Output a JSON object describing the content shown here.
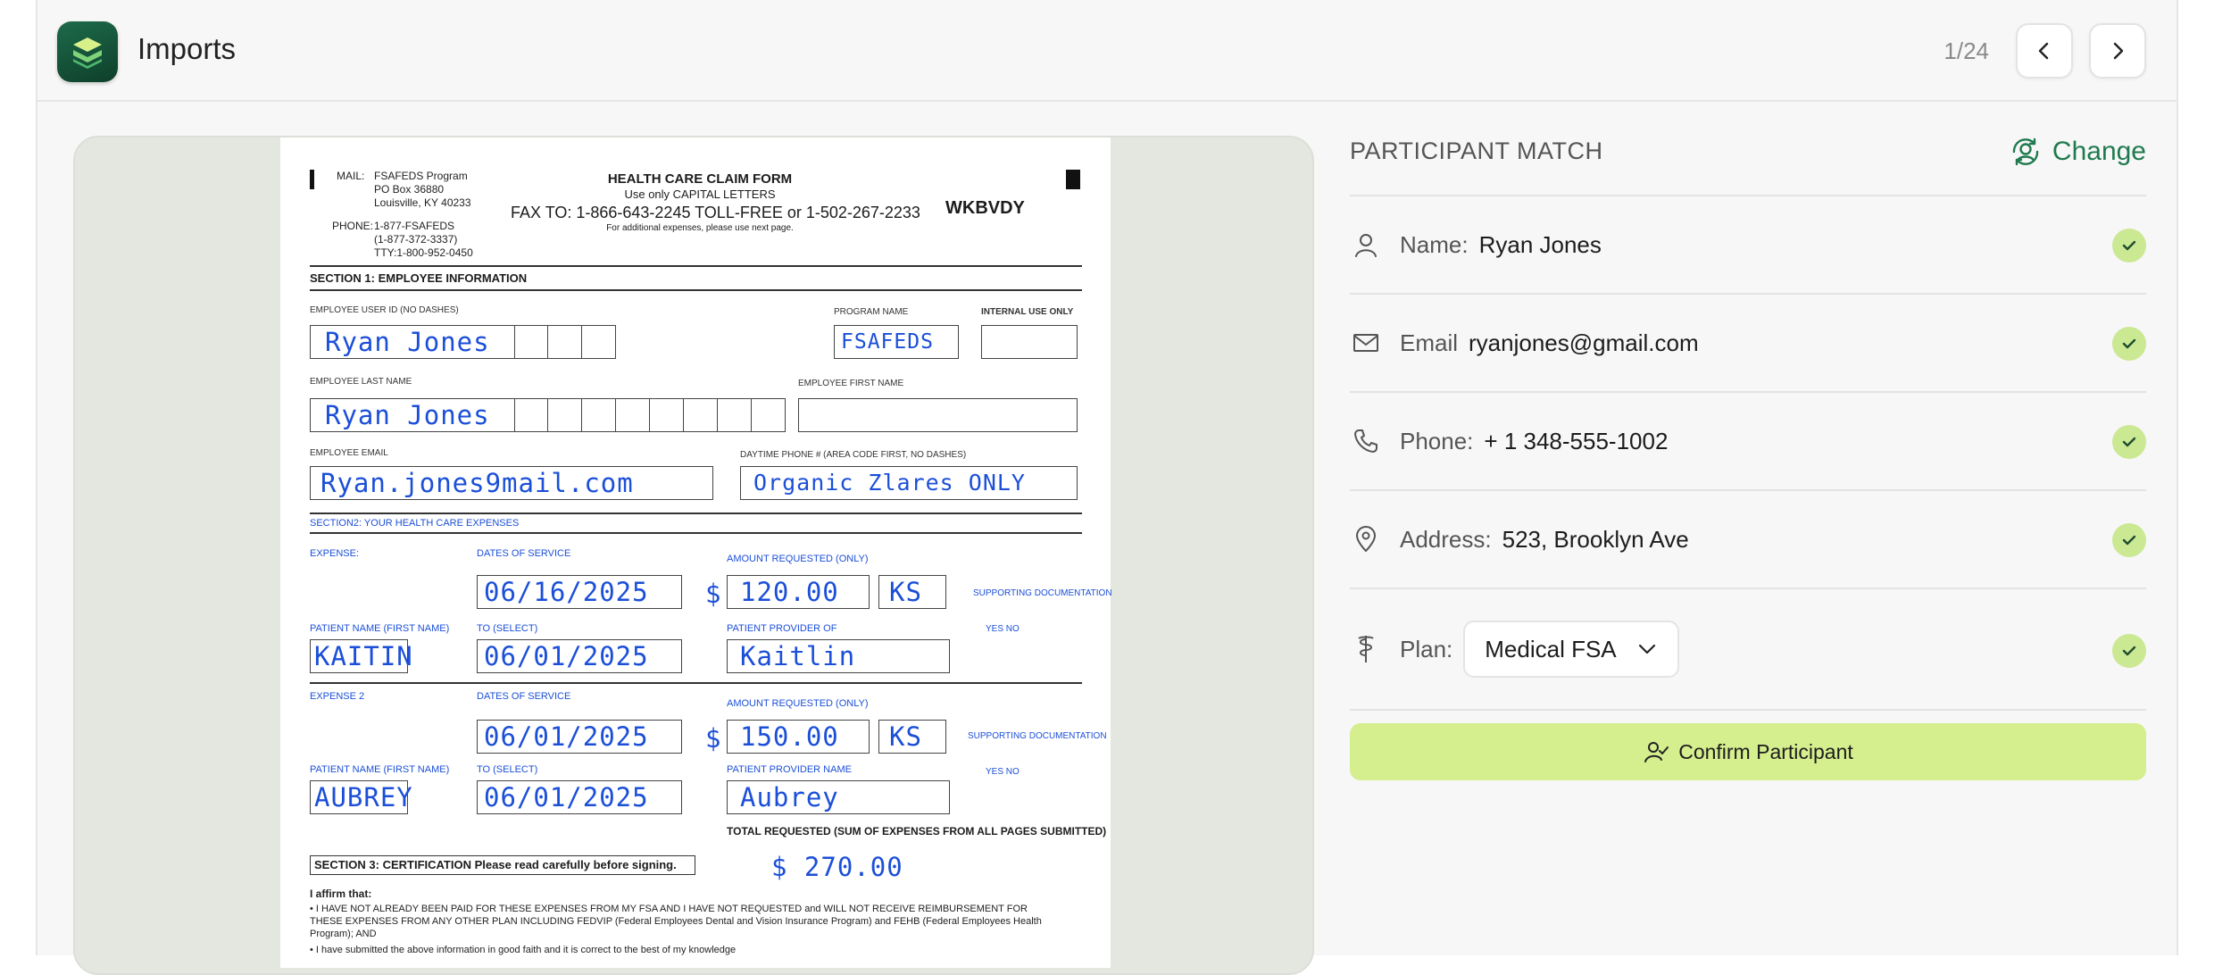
{
  "header": {
    "app_title": "Imports",
    "pager": "1/24",
    "logo_icon": "layers-logo-icon",
    "prev_icon": "chevron-left-icon",
    "next_icon": "chevron-right-icon"
  },
  "document": {
    "mail_label": "MAIL:",
    "mail_lines": [
      "FSAFEDS Program",
      "PO Box 36880",
      "Louisville, KY 40233"
    ],
    "phone_label": "PHONE:",
    "phone_lines": [
      "1-877-FSAFEDS",
      "(1-877-372-3337)",
      "TTY:1-800-952-0450"
    ],
    "form_title": "HEALTH CARE CLAIM FORM",
    "form_subtitle": "Use only CAPITAL LETTERS",
    "fax_line": "FAX TO:  1-866-643-2245  TOLL-FREE or 1-502-267-2233",
    "fax_sub": "For additional expenses, please use next page.",
    "form_code": "WKBVDY",
    "section1": "SECTION 1:  EMPLOYEE INFORMATION",
    "employee_user_id_label": "EMPLOYEE USER ID (NO DASHES)",
    "program_name_label": "PROGRAM NAME",
    "internal_use_label": "INTERNAL USE ONLY",
    "employee_user_id_value": "Ryan Jones",
    "program_name_value": "FSAFEDS",
    "last_name_label": "EMPLOYEE LAST NAME",
    "first_name_label": "EMPLOYEE FIRST NAME",
    "last_name_value": "Ryan Jones",
    "email_label": "EMPLOYEE EMAIL",
    "phone_field_label": "DAYTIME PHONE # (AREA CODE FIRST, NO DASHES)",
    "email_value": "Ryan.jones9mail.com",
    "phone_value": "Organic Zlares ONLY",
    "section2": "SECTION2:  YOUR HEALTH CARE EXPENSES",
    "exp1_label": "EXPENSE:",
    "exp1_dates_label": "DATES OF SERVICE",
    "exp1_amount_label": "AMOUNT REQUESTED (ONLY)",
    "exp1_date_from": "06/16/2025",
    "exp1_amount": "120.00",
    "exp1_cents": "KS",
    "exp1_patient_label": "PATIENT NAME (FIRST NAME)",
    "exp1_to_label": "TO (SELECT)",
    "exp1_provider_label": "PATIENT PROVIDER OF",
    "exp1_patient": "KAITIN",
    "exp1_date_to": "06/01/2025",
    "exp1_provider": "Kaitlin",
    "exp1_support": "SUPPORTING DOCUMENTATION",
    "exp1_yes_no": "YES      NO",
    "exp2_label": "EXPENSE 2",
    "exp2_dates_label": "DATES OF SERVICE",
    "exp2_amount_label": "AMOUNT REQUESTED (ONLY)",
    "exp2_date_from": "06/01/2025",
    "exp2_amount": "150.00",
    "exp2_cents": "KS",
    "exp2_patient_label": "PATIENT NAME (FIRST NAME)",
    "exp2_to_label": "TO (SELECT)",
    "exp2_provider_label": "PATIENT PROVIDER NAME",
    "exp2_patient": "AUBREY",
    "exp2_date_to": "06/01/2025",
    "exp2_provider": "Aubrey",
    "exp2_support": "SUPPORTING DOCUMENTATION",
    "exp2_yes_no": "YES      NO",
    "dollar": "$",
    "total_label": "TOTAL REQUESTED (SUM OF EXPENSES FROM ALL PAGES SUBMITTED)",
    "total_value": "$ 270.00",
    "section3": "SECTION 3:  CERTIFICATION    Please read carefully before signing.",
    "affirm": "I affirm that:",
    "affirm_line1": "• I HAVE NOT ALREADY BEEN PAID FOR THESE EXPENSES FROM MY FSA AND I HAVE NOT REQUESTED and WILL NOT RECEIVE REIMBURSEMENT FOR",
    "affirm_line2": "   THESE EXPENSES FROM ANY OTHER PLAN INCLUDING FEDVIP (Federal Employees Dental and Vision Insurance Program) and FEHB (Federal Employees Health",
    "affirm_line3": "   Program); AND",
    "affirm_line4": "• I have submitted the above information in good faith and it is correct to the best of my knowledge"
  },
  "participant": {
    "title": "PARTICIPANT MATCH",
    "change_label": "Change",
    "change_icon": "user-switch-icon",
    "name_label": "Name:",
    "name_value": "Ryan Jones",
    "email_label": "Email",
    "email_value": "ryanjones@gmail.com",
    "phone_label": "Phone:",
    "phone_value": "+ 1 348-555-1002",
    "address_label": "Address:",
    "address_value": "523, Brooklyn Ave",
    "plan_label": "Plan:",
    "plan_value": "Medical FSA",
    "confirm_label": "Confirm Participant",
    "check_color": "#cbe892",
    "accent_color": "#1f7a4f",
    "confirm_color": "#d5ee8e"
  }
}
